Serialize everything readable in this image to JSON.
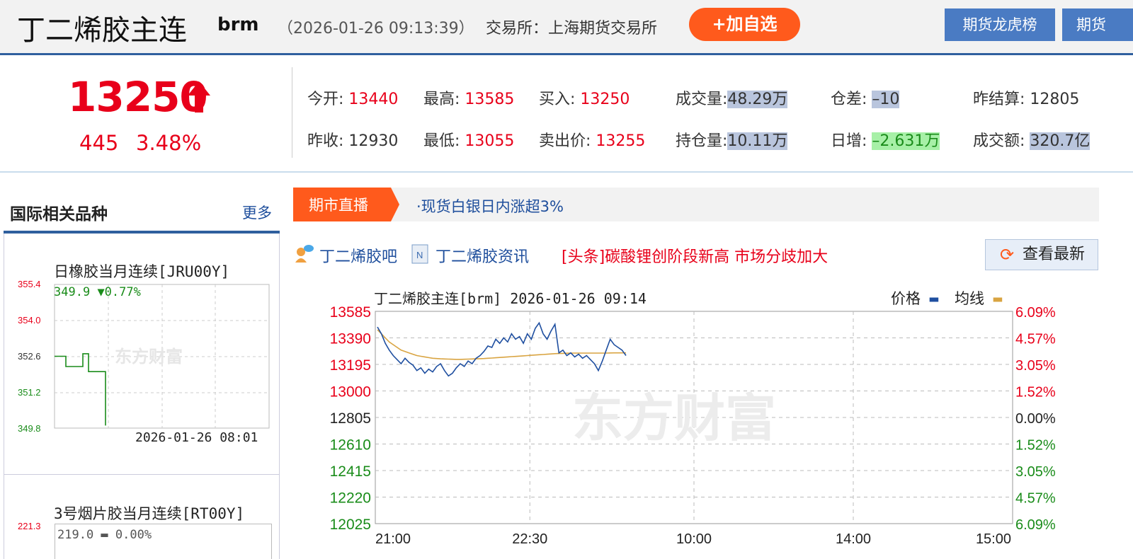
{
  "header": {
    "name": "丁二烯胶主连",
    "code": "brm",
    "time": "（2026-01-26 09:13:39）",
    "exchange": "交易所：上海期货交易所",
    "add_button": "+加自选",
    "nav_buttons": [
      "期货龙虎榜",
      "期货"
    ]
  },
  "quote": {
    "price": "13250",
    "change": "445",
    "change_pct": "3.48%",
    "fields": [
      {
        "label": "今开:",
        "value": "13440",
        "color": "red"
      },
      {
        "label": "最高:",
        "value": "13585",
        "color": "red"
      },
      {
        "label": "买入:",
        "value": "13250",
        "color": "red"
      },
      {
        "label": "成交量:",
        "value": "48.29万",
        "color": "hl"
      },
      {
        "label": "仓差:",
        "value": "–10",
        "color": "hl"
      },
      {
        "label": "昨结算:",
        "value": "12805",
        "color": "plain"
      },
      {
        "label": "昨收:",
        "value": "12930",
        "color": "plain"
      },
      {
        "label": "最低:",
        "value": "13055",
        "color": "red"
      },
      {
        "label": "卖出价:",
        "value": "13255",
        "color": "red"
      },
      {
        "label": "持仓量:",
        "value": "10.11万",
        "color": "hl"
      },
      {
        "label": "日增:",
        "value": "–2.631万",
        "color": "hlg"
      },
      {
        "label": "成交额:",
        "value": "320.7亿",
        "color": "hl"
      }
    ]
  },
  "sidebar": {
    "title": "国际相关品种",
    "more": "更多",
    "items": [
      {
        "title": "日橡胶当月连续[JRU00Y]",
        "last": "349.9",
        "change": "▼0.77%",
        "y_ticks": [
          "355.4",
          "354.0",
          "352.6",
          "351.2",
          "349.8"
        ],
        "time": "2026-01-26 08:01",
        "watermark": "东方财富"
      },
      {
        "title": "3号烟片胶当月连续[RT00Y]",
        "last": "219.0",
        "change": "0.00%",
        "y_ticks": [
          "221.3"
        ]
      }
    ]
  },
  "news": {
    "tab": "期市直播",
    "headline": "·现货白银日内涨超3%",
    "bar_link": "丁二烯胶吧",
    "info_link": "丁二烯胶资讯",
    "top_story": "[头条]碳酸锂创阶段新高 市场分歧加大",
    "refresh": "查看最新"
  },
  "chart_data": {
    "type": "line",
    "title": "丁二烯胶主连[brm] 2026-01-26 09:14",
    "legend": [
      "价格",
      "均线"
    ],
    "watermark": "东方财富",
    "colors": {
      "price": "#1f4fa0",
      "avg": "#d9a441"
    },
    "y_ticks_left": [
      "13585",
      "13390",
      "13195",
      "13000",
      "12805",
      "12610",
      "12415",
      "12220",
      "12025"
    ],
    "y_ticks_right": [
      "6.09%",
      "4.57%",
      "3.05%",
      "1.52%",
      "0.00%",
      "1.52%",
      "3.05%",
      "4.57%",
      "6.09%"
    ],
    "x_ticks": [
      "21:00",
      "22:30",
      "10:00",
      "14:00",
      "15:00"
    ],
    "ylim": [
      12025,
      13585
    ],
    "price": [
      13470,
      13420,
      13350,
      13300,
      13260,
      13230,
      13200,
      13240,
      13210,
      13190,
      13150,
      13170,
      13130,
      13160,
      13140,
      13180,
      13200,
      13150,
      13110,
      13130,
      13170,
      13200,
      13180,
      13220,
      13200,
      13240,
      13260,
      13290,
      13330,
      13320,
      13380,
      13350,
      13390,
      13360,
      13420,
      13380,
      13400,
      13350,
      13420,
      13380,
      13460,
      13500,
      13420,
      13380,
      13440,
      13490,
      13280,
      13300,
      13260,
      13280,
      13250,
      13270,
      13240,
      13260,
      13230,
      13200,
      13150,
      13220,
      13300,
      13380,
      13340,
      13320,
      13300,
      13260
    ],
    "avg": [
      13450,
      13420,
      13390,
      13360,
      13340,
      13320,
      13300,
      13290,
      13280,
      13270,
      13260,
      13255,
      13250,
      13245,
      13240,
      13238,
      13236,
      13235,
      13234,
      13233,
      13232,
      13232,
      13233,
      13234,
      13235,
      13236,
      13237,
      13238,
      13240,
      13242,
      13244,
      13246,
      13248,
      13250,
      13252,
      13254,
      13256,
      13258,
      13260,
      13262,
      13264,
      13266,
      13268,
      13270,
      13272,
      13274,
      13275,
      13276,
      13277,
      13278,
      13278,
      13278,
      13278,
      13278,
      13278,
      13278,
      13278,
      13278,
      13278,
      13279,
      13280,
      13280,
      13280,
      13280
    ],
    "mini_chart": {
      "ylim": [
        349.8,
        355.4
      ],
      "values": [
        352.6,
        352.6,
        352.2,
        352.2,
        352.2,
        352.7,
        352.0,
        352.0,
        352.0,
        349.9
      ]
    }
  }
}
